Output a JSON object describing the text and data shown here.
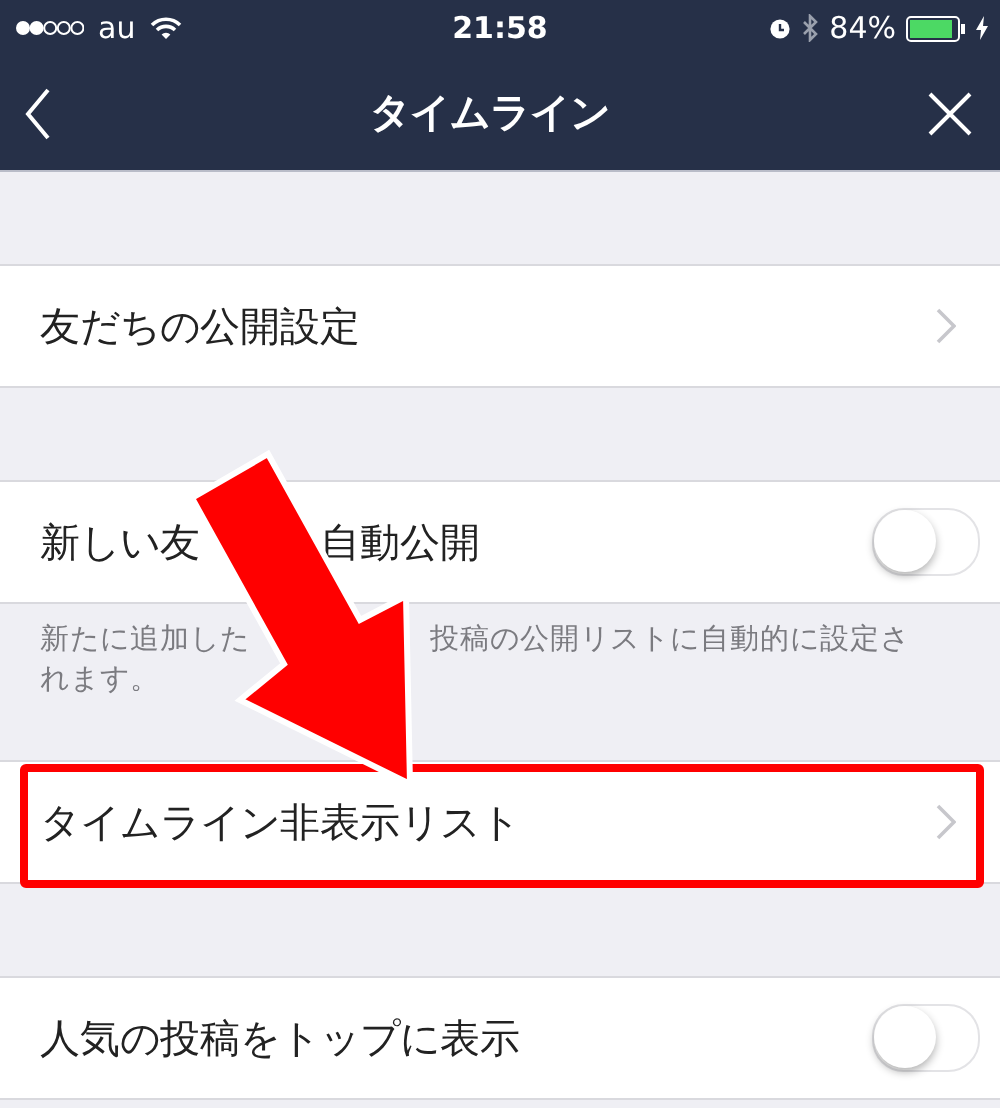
{
  "status_bar": {
    "carrier": "au",
    "time": "21:58",
    "battery": "84%"
  },
  "nav": {
    "title": "タイムライン"
  },
  "sections": [
    {
      "kind": "link",
      "label_parts": [
        "友だちの公開設定"
      ],
      "highlighted": false
    },
    {
      "kind": "toggle",
      "label_parts": [
        "新しい友",
        "自動公開"
      ],
      "on": false,
      "note_lines": [
        [
          "新たに追加した",
          "投稿の公開リストに自動的に設定さ"
        ],
        [
          "れます。"
        ]
      ]
    },
    {
      "kind": "link",
      "label_parts": [
        "タイムライン非表示リスト"
      ],
      "highlighted": true
    },
    {
      "kind": "toggle",
      "label_parts": [
        "人気の投稿をトップに表示"
      ],
      "on": false
    }
  ]
}
